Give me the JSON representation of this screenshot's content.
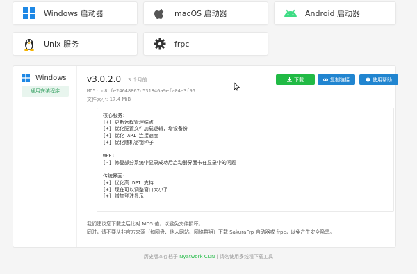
{
  "launchers": [
    {
      "label": "Windows 启动器",
      "icon": "windows-icon"
    },
    {
      "label": "macOS 启动器",
      "icon": "apple-icon"
    },
    {
      "label": "Android 启动器",
      "icon": "android-icon"
    },
    {
      "label": "Unix 服务",
      "icon": "linux-tux-icon"
    },
    {
      "label": "frpc",
      "icon": "gear-icon"
    }
  ],
  "sidebar": {
    "os_name": "Windows",
    "tab_label": "通用安装程序"
  },
  "release": {
    "version": "v3.0.2.0",
    "age": "3 个月前",
    "md5": "MD5: d8cfe24648867c531846a9efa04e3f95",
    "size": "文件大小: 17.4 MiB"
  },
  "buttons": {
    "download": "下载",
    "copy_link": "复制链接",
    "help": "使用帮助"
  },
  "changelog": [
    "核心服务:",
    "[+] 更新远程管理结点",
    "[+] 优化配置文件加载逻辑，增设备份",
    "[+] 优化 API 连接速度",
    "[+] 优化随机密钥种子",
    "",
    "WPF:",
    "[-] 修复部分系统中显录成功后启动器界面卡在显录中的问题",
    "",
    "传统界面:",
    "[+] 优化高 DPI 支持",
    "[+] 现在可以调整窗口大小了",
    "[+] 增加登注显示"
  ],
  "notice": {
    "line1": "我们建议您下载之后比对 MD5 值，以避免文件损坏。",
    "line2": "同时，请不要从非官方来源（如网盘、他人网站、网络群组）下载 SakuraFrp 启动器或 frpc，以免产生安全隐患。"
  },
  "footer": {
    "prefix": "历史版本存档于 ",
    "link1": "Nyatwork CDN",
    "sep": " | ",
    "suffix": "请勿使用多线程下载工具"
  },
  "colors": {
    "green": "#21ba45",
    "blue": "#2185d0",
    "android": "#3ddc84"
  }
}
